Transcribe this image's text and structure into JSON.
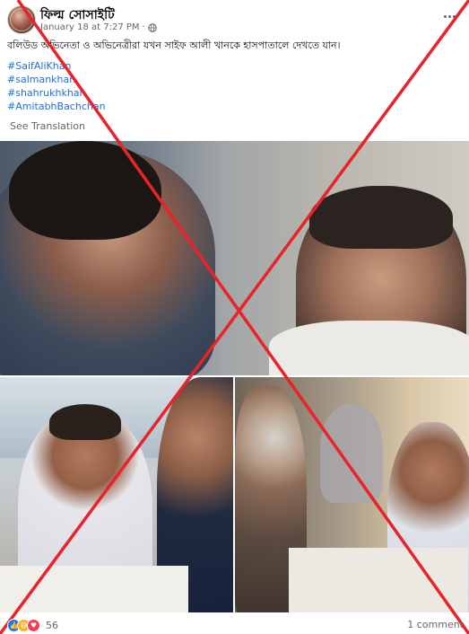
{
  "post": {
    "page_name": "ফিল্ম সোসাইটি",
    "timestamp": "January 18 at 7:27 PM",
    "separator": "·",
    "privacy_icon": "globe-icon",
    "caption": "বলিউড অভিনেতা ও অভিনেত্রীরা যখন সাইফ আলী খানকে হাসপাতালে দেখতে যান।",
    "hashtags": [
      "#SaifAliKhan",
      "#salmankhan",
      "#shahrukhkhan",
      "#AmitabhBachchan"
    ],
    "see_translation": "See Translation"
  },
  "footer": {
    "reaction_icons": [
      "like-icon",
      "haha-icon",
      "love-icon"
    ],
    "reaction_count": "56",
    "comment_count": "1 comment"
  },
  "overlay": {
    "x_color": "#e8232a"
  }
}
